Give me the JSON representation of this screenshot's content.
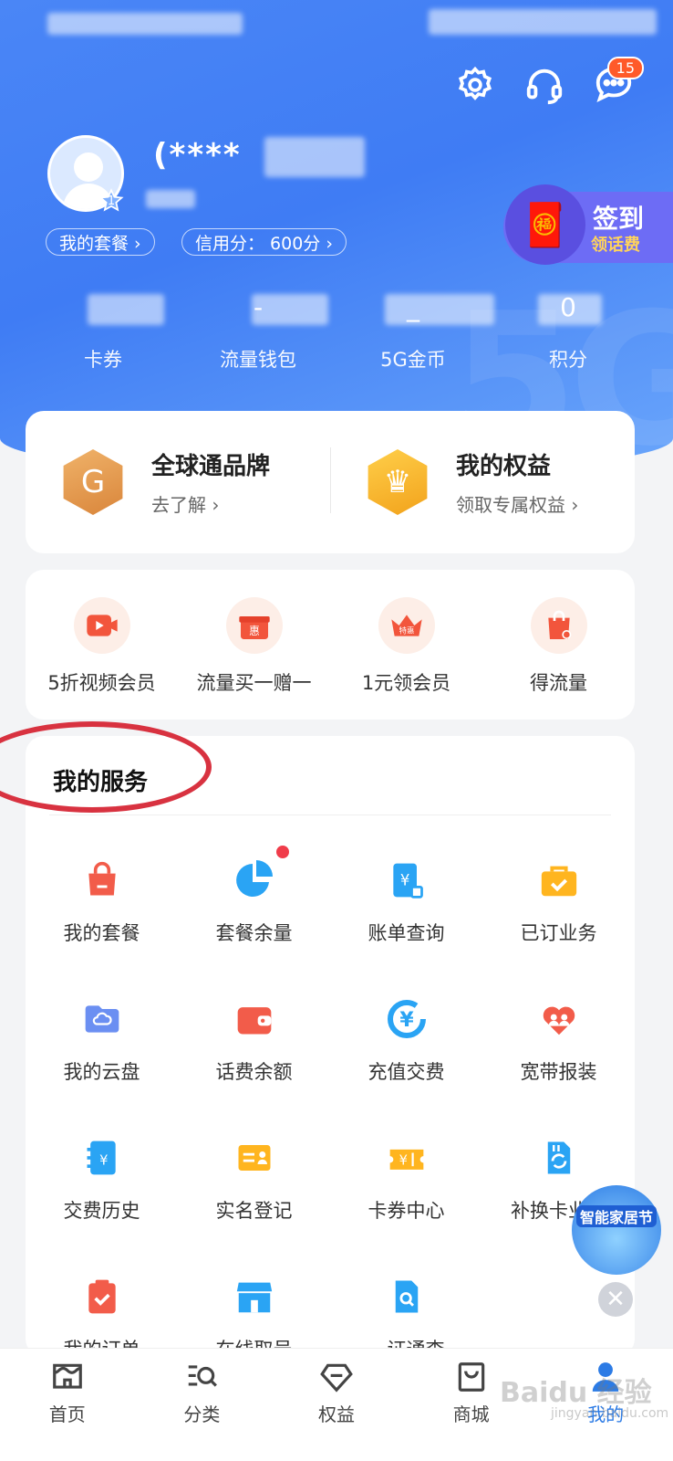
{
  "header": {
    "username": "(**** ",
    "badge_count": "15",
    "level": "1",
    "pills": [
      {
        "label": "我的套餐 ›"
      },
      {
        "label": "信用分： 600分 ›"
      }
    ],
    "checkin": {
      "title": "签到",
      "subtitle": "领话费"
    },
    "stats": [
      {
        "value": "",
        "label": "卡券"
      },
      {
        "value": "-",
        "label": "流量钱包"
      },
      {
        "value": "_",
        "label": "5G金币"
      },
      {
        "value": "0",
        "label": "积分"
      }
    ]
  },
  "brand_card": {
    "left": {
      "title": "全球通品牌",
      "subtitle": "去了解 ›"
    },
    "right": {
      "title": "我的权益",
      "subtitle": "领取专属权益 ›"
    }
  },
  "promos": [
    {
      "label": "5折视频会员",
      "icon": "video-icon"
    },
    {
      "label": "流量买一赠一",
      "icon": "gift-box-icon"
    },
    {
      "label": "1元领会员",
      "icon": "crown-icon"
    },
    {
      "label": "得流量",
      "icon": "shopping-bag-icon"
    }
  ],
  "services": {
    "title": "我的服务",
    "items": [
      {
        "label": "我的套餐",
        "icon": "bag-icon"
      },
      {
        "label": "套餐余量",
        "icon": "pie-chart-icon"
      },
      {
        "label": "账单查询",
        "icon": "bill-icon"
      },
      {
        "label": "已订业务",
        "icon": "briefcase-icon"
      },
      {
        "label": "我的云盘",
        "icon": "cloud-folder-icon"
      },
      {
        "label": "话费余额",
        "icon": "wallet-icon"
      },
      {
        "label": "充值交费",
        "icon": "yuan-refresh-icon"
      },
      {
        "label": "宽带报装",
        "icon": "heart-people-icon"
      },
      {
        "label": "交费历史",
        "icon": "notebook-icon"
      },
      {
        "label": "实名登记",
        "icon": "id-card-icon"
      },
      {
        "label": "卡券中心",
        "icon": "coupon-icon"
      },
      {
        "label": "补换卡业务",
        "icon": "sim-card-icon"
      },
      {
        "label": "我的订单",
        "icon": "clipboard-check-icon"
      },
      {
        "label": "在线取号",
        "icon": "store-icon"
      },
      {
        "label": "一证通查",
        "icon": "sim-search-icon"
      }
    ]
  },
  "floating_ad": {
    "label": "智能家居节"
  },
  "tabbar": [
    {
      "label": "首页"
    },
    {
      "label": "分类"
    },
    {
      "label": "权益"
    },
    {
      "label": "商城"
    },
    {
      "label": "我的"
    }
  ],
  "watermark": {
    "text": "Baidu 经验",
    "url": "jingyan.baidu.com"
  },
  "colors": {
    "primary": "#4a86f6",
    "accent_red": "#f03c4a",
    "active_tab": "#2c7be5"
  }
}
